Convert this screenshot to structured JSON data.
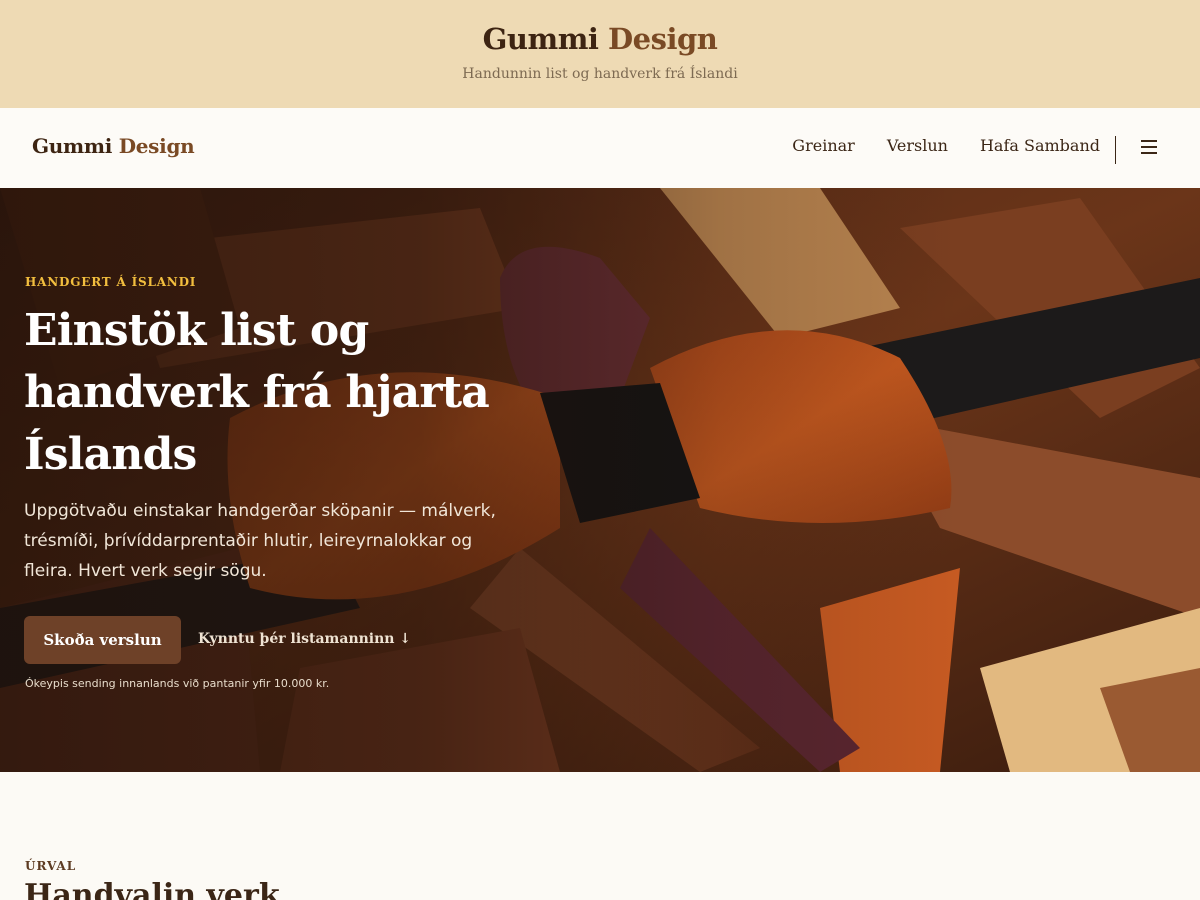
{
  "banner": {
    "title_part1": "Gummi",
    "title_part2": "Design",
    "tagline": "Handunnin list og handverk frá Íslandi"
  },
  "nav": {
    "logo_part1": "Gummi",
    "logo_part2": "Design",
    "links": [
      {
        "label": "Greinar"
      },
      {
        "label": "Verslun"
      },
      {
        "label": "Hafa Samband"
      }
    ],
    "menu_icon": "hamburger-icon"
  },
  "hero": {
    "eyebrow": "HANDGERT Á ÍSLANDI",
    "title": "Einstök list og handverk frá hjarta Íslands",
    "lead": "Uppgötvaðu einstakar handgerðar sköpanir — málverk, trésmíði, þrívíddarprentaðir hlutir, leireyrnalokkar og fleira. Hvert verk segir sögu.",
    "cta_label": "Skoða verslun",
    "secondary_link": "Kynntu þér listamanninn ↓",
    "shipping_note": "Ókeypis sending innanlands við pantanir yfir 10.000 kr.",
    "image": "wooden-bow-tie-photo"
  },
  "featured": {
    "eyebrow": "ÚRVAL",
    "title": "Handvalin verk"
  },
  "colors": {
    "banner_bg": "#eedab4",
    "brand_dark": "#3d2412",
    "brand_accent": "#7a4a25",
    "cta_bg": "#6e4128",
    "eyebrow_gold": "#f2be3e",
    "page_bg": "#fcfaf5"
  }
}
